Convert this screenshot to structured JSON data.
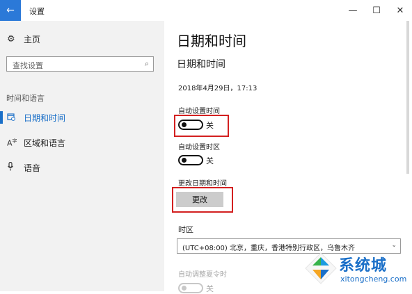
{
  "window": {
    "title": "设置",
    "back_glyph": "←",
    "minimize_glyph": "—",
    "maximize_glyph": "☐",
    "close_glyph": "✕"
  },
  "sidebar": {
    "home_label": "主页",
    "search_placeholder": "查找设置",
    "section_title": "时间和语言",
    "items": [
      {
        "label": "日期和时间",
        "icon": "calendar-clock-icon",
        "active": true
      },
      {
        "label": "区域和语言",
        "icon": "language-icon",
        "active": false
      },
      {
        "label": "语音",
        "icon": "microphone-icon",
        "active": false
      }
    ]
  },
  "main": {
    "page_title": "日期和时间",
    "section_title": "日期和时间",
    "current_datetime": "2018年4月29日，17:13",
    "auto_time": {
      "label": "自动设置时间",
      "state": "关"
    },
    "auto_timezone": {
      "label": "自动设置时区",
      "state": "关"
    },
    "change_datetime": {
      "label": "更改日期和时间",
      "button": "更改"
    },
    "timezone": {
      "label": "时区",
      "value": "(UTC+08:00) 北京，重庆，香港特别行政区，乌鲁木齐"
    },
    "dst": {
      "label": "自动调整夏令时",
      "state": "关"
    }
  },
  "watermark": {
    "brand": "系统城",
    "url": "xitongcheng.com"
  },
  "colors": {
    "accent": "#1a6fc8",
    "highlight": "#d32020",
    "back_button": "#2b79d8"
  }
}
